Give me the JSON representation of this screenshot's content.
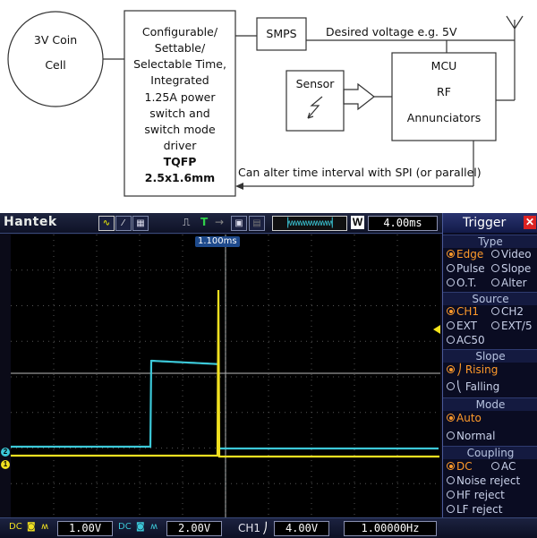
{
  "diagram": {
    "coin_cell": [
      "3V Coin",
      "Cell"
    ],
    "timer_block": [
      "Configurable/",
      "Settable/",
      "Selectable Time,",
      "Integrated",
      "1.25A power",
      "switch and",
      "switch mode",
      "driver"
    ],
    "timer_package": [
      "TQFP",
      "2.5x1.6mm"
    ],
    "smps": "SMPS",
    "sensor": "Sensor",
    "mcu": [
      "MCU",
      "RF",
      "Annunciators"
    ],
    "voltage_note": "Desired voltage e.g. 5V",
    "spi_note": "Can alter time interval with SPI (or parallel)"
  },
  "scope": {
    "brand": "Hantek",
    "trigger_symbol": "T",
    "w_label": "W",
    "timebase": "4.00ms",
    "time_marker": "1.100ms",
    "ch1_marker": "1",
    "ch2_marker": "2",
    "bottom": {
      "ch1_volts": "1.00V",
      "ch2_volts": "2.00V",
      "trig_src": "CH1",
      "trig_level": "4.00V",
      "frequency": "1.00000Hz",
      "dc_label": "DC"
    },
    "panel": {
      "title": "Trigger",
      "close": "✕",
      "sections": {
        "type": "Type",
        "source": "Source",
        "slope": "Slope",
        "mode": "Mode",
        "coupling": "Coupling"
      },
      "type_options": [
        "Edge",
        "Video",
        "Pulse",
        "Slope",
        "O.T.",
        "Alter"
      ],
      "source_options": [
        "CH1",
        "CH2",
        "EXT",
        "EXT/5",
        "AC50"
      ],
      "slope_options": [
        "Rising",
        "Falling"
      ],
      "mode_options": [
        "Auto",
        "Normal"
      ],
      "coupling_options": [
        "DC",
        "AC",
        "Noise reject",
        "HF reject",
        "LF reject"
      ]
    },
    "colors": {
      "ch1": "#f0e020",
      "ch2": "#3cc8d8",
      "selected": "#ff9a2a"
    }
  }
}
